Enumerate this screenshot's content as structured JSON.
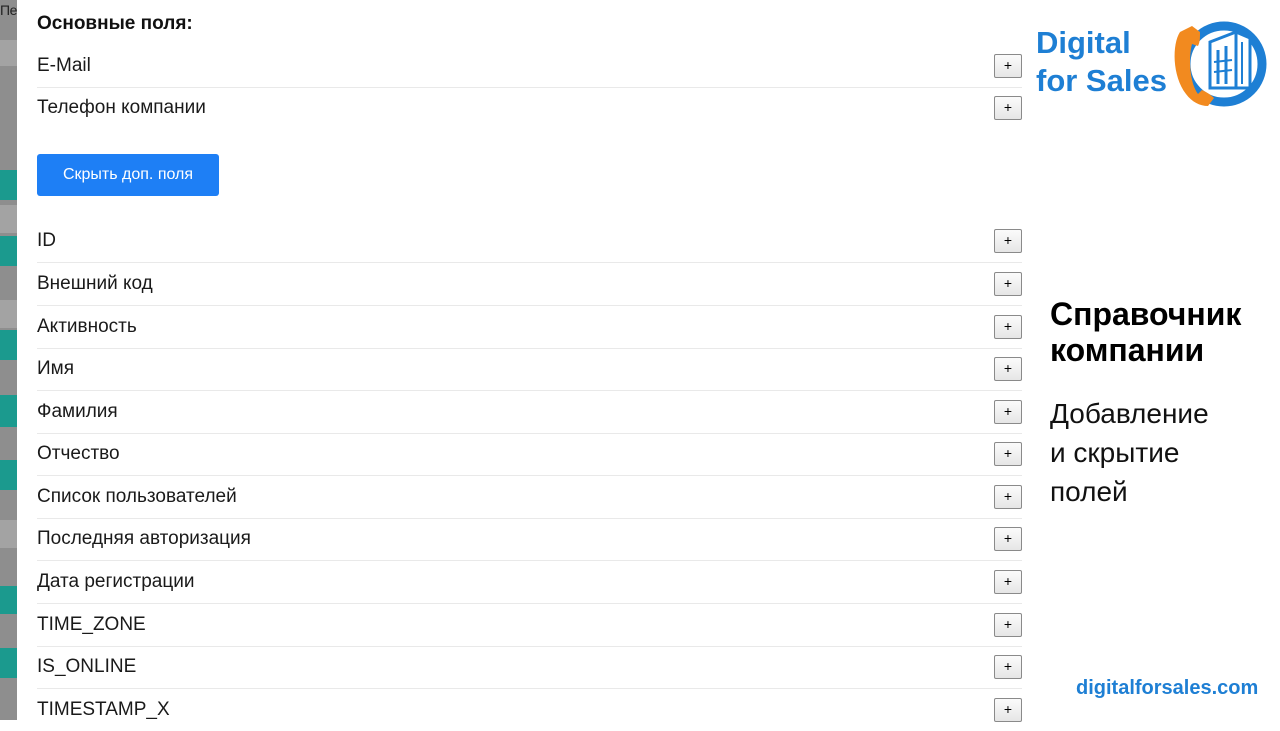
{
  "background_page": {
    "cut_text": "Пе"
  },
  "panel": {
    "section_title": "Основные поля:",
    "main_fields": [
      {
        "label": "E-Mail",
        "button": "+"
      },
      {
        "label": "Телефон компании",
        "button": "+"
      }
    ],
    "toggle_button": "Скрыть доп. поля",
    "extra_fields": [
      {
        "label": "ID",
        "button": "+"
      },
      {
        "label": "Внешний код",
        "button": "+"
      },
      {
        "label": "Активность",
        "button": "+"
      },
      {
        "label": "Имя",
        "button": "+"
      },
      {
        "label": "Фамилия",
        "button": "+"
      },
      {
        "label": "Отчество",
        "button": "+"
      },
      {
        "label": "Список пользователей",
        "button": "+"
      },
      {
        "label": "Последняя авторизация",
        "button": "+"
      },
      {
        "label": "Дата регистрации",
        "button": "+"
      },
      {
        "label": "TIME_ZONE",
        "button": "+"
      },
      {
        "label": "IS_ONLINE",
        "button": "+"
      },
      {
        "label": "TIMESTAMP_X",
        "button": "+"
      }
    ]
  },
  "branding": {
    "logo_line1": "Digital",
    "logo_line2": "for Sales",
    "heading_line1": "Справочник",
    "heading_line2": "компании",
    "sub_line1": "Добавление",
    "sub_line2": "и скрытие",
    "sub_line3": "полей",
    "website": "digitalforsales.com",
    "accent_color": "#1e7fd4",
    "logo_orange": "#f28a1f"
  }
}
